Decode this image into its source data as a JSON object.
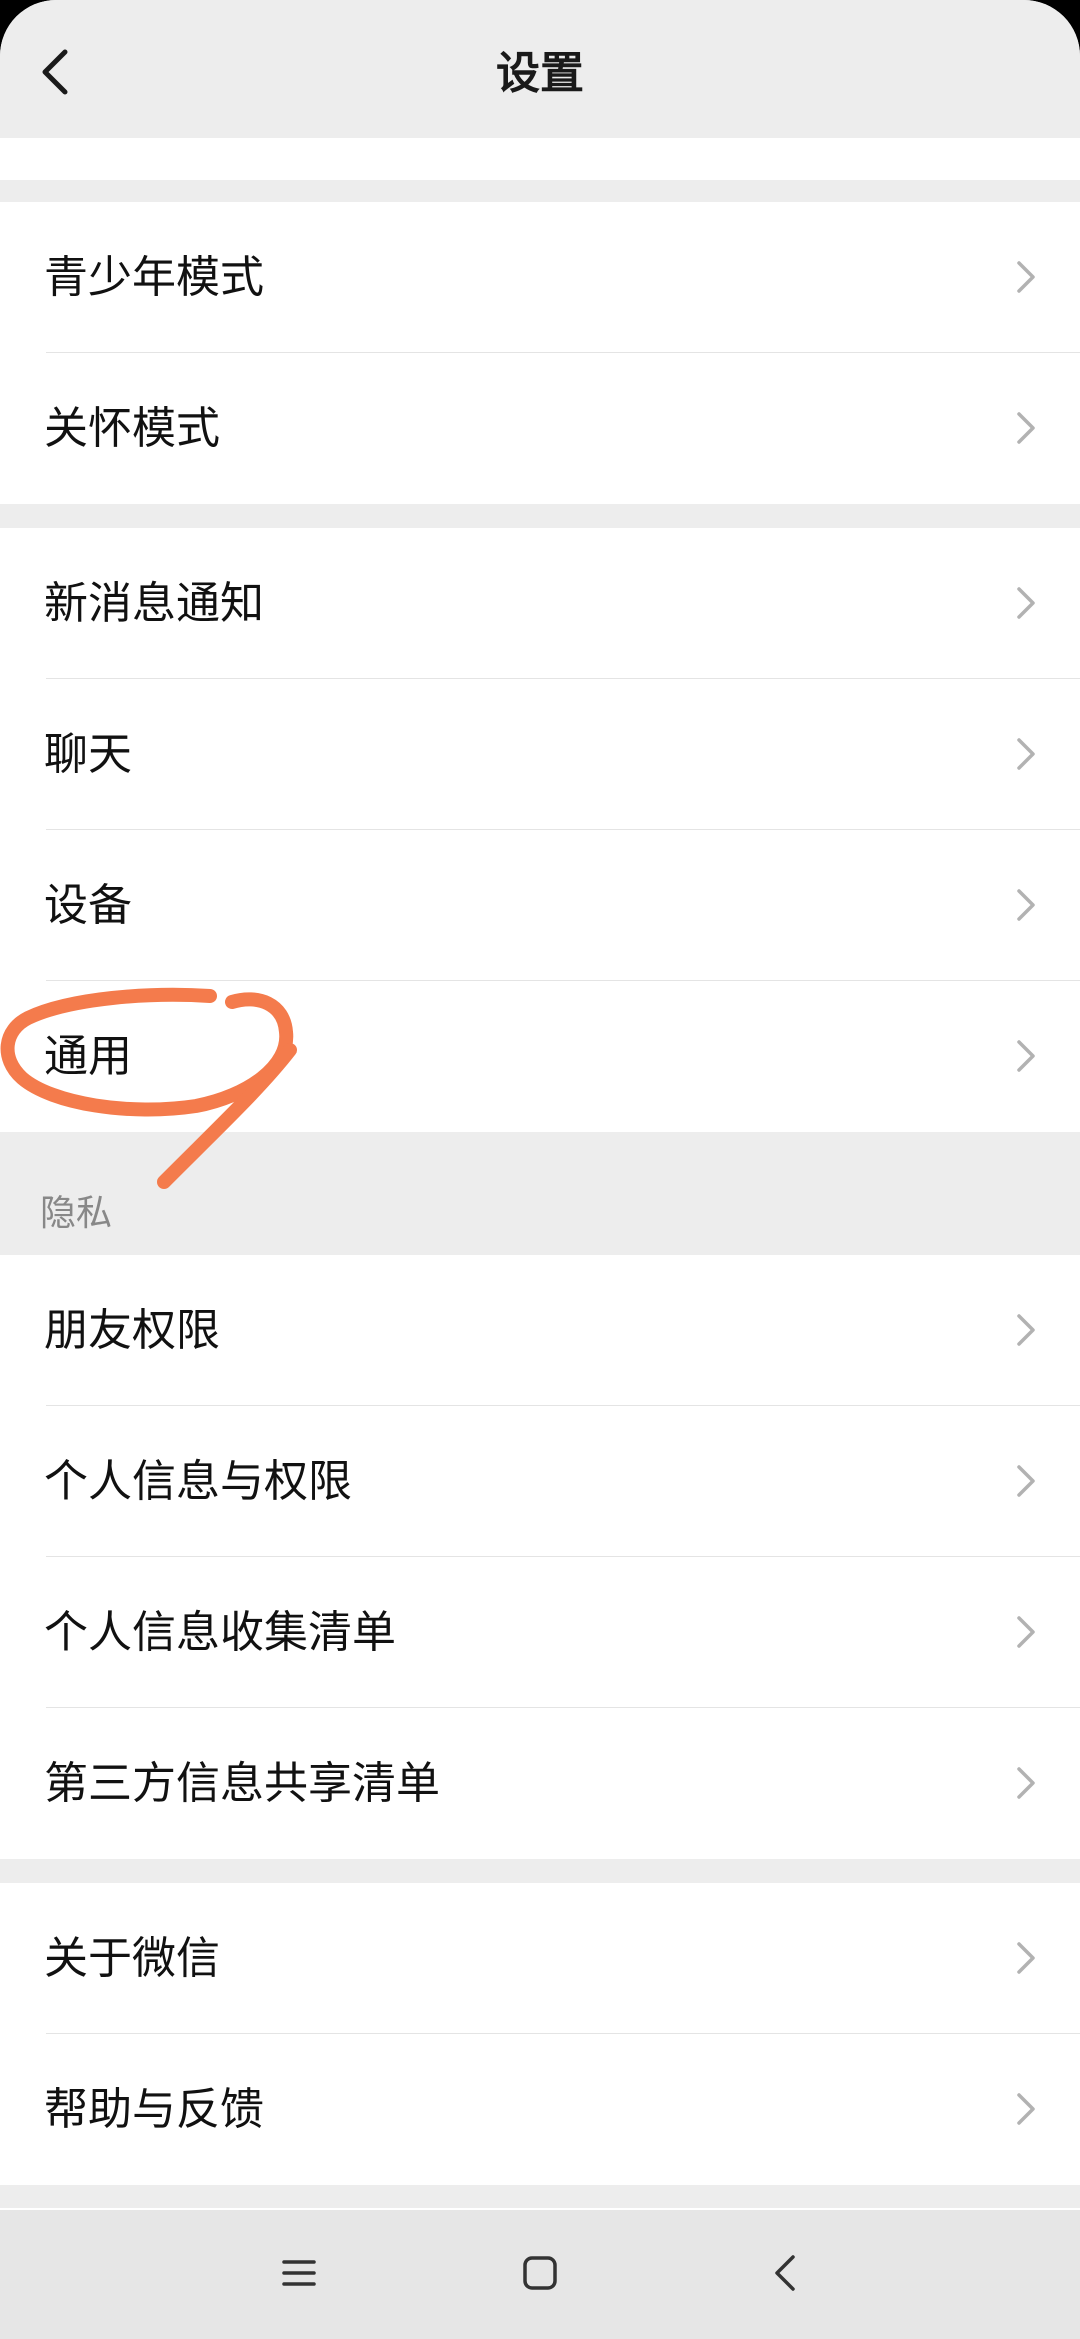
{
  "header": {
    "title": "设置",
    "back_icon": "chevron-left-icon"
  },
  "groups": [
    {
      "items": [
        "青少年模式",
        "关怀模式"
      ]
    },
    {
      "items": [
        "新消息通知",
        "聊天",
        "设备",
        "通用"
      ]
    },
    {
      "section_title": "隐私",
      "items": [
        "朋友权限",
        "个人信息与权限",
        "个人信息收集清单",
        "第三方信息共享清单"
      ]
    },
    {
      "items": [
        "关于微信",
        "帮助与反馈"
      ]
    }
  ],
  "annotation": {
    "color": "#f47b4c",
    "target": "通用"
  },
  "nav_bar": {
    "icons": [
      "menu-icon",
      "home-icon",
      "back-icon"
    ]
  },
  "colors": {
    "background": "#ededed",
    "card": "#ffffff",
    "text": "#111111",
    "secondary_text": "#888888"
  }
}
